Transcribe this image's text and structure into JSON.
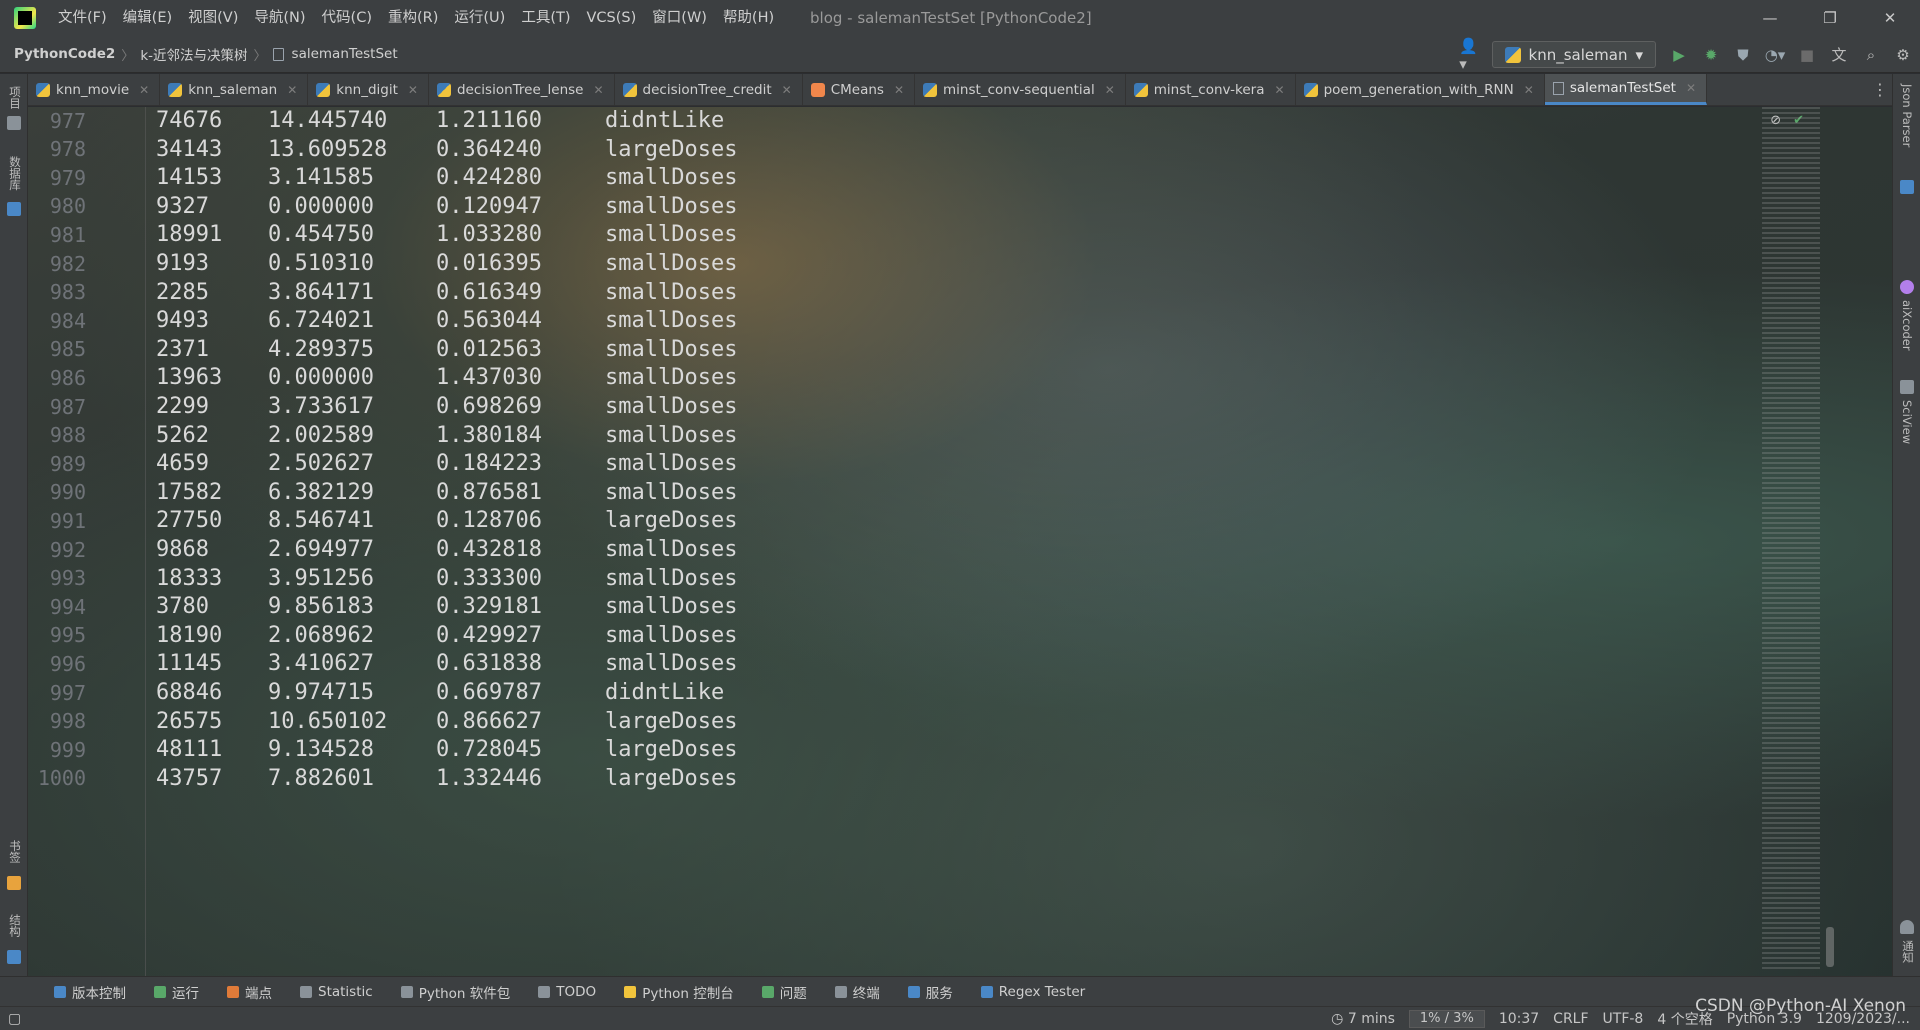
{
  "window": {
    "title": "blog - salemanTestSet [PythonCode2]",
    "controls": {
      "minimize": "—",
      "restore": "❐",
      "close": "✕"
    }
  },
  "menu": [
    "文件(F)",
    "编辑(E)",
    "视图(V)",
    "导航(N)",
    "代码(C)",
    "重构(R)",
    "运行(U)",
    "工具(T)",
    "VCS(S)",
    "窗口(W)",
    "帮助(H)"
  ],
  "breadcrumb": {
    "project": "PythonCode2",
    "folder": "k-近邻法与决策树",
    "file": "salemanTestSet"
  },
  "run_config": {
    "label": "knn_saleman"
  },
  "tabs": [
    {
      "label": "knn_movie",
      "icon": "python-file-icon"
    },
    {
      "label": "knn_saleman",
      "icon": "python-file-icon"
    },
    {
      "label": "knn_digit",
      "icon": "python-file-icon"
    },
    {
      "label": "decisionTree_lense",
      "icon": "python-file-icon"
    },
    {
      "label": "decisionTree_credit",
      "icon": "python-file-icon"
    },
    {
      "label": "CMeans",
      "icon": "python-file-icon"
    },
    {
      "label": "minst_conv-sequential",
      "icon": "python-file-icon"
    },
    {
      "label": "minst_conv-kera",
      "icon": "python-file-icon"
    },
    {
      "label": "poem_generation_with_RNN",
      "icon": "python-file-icon"
    },
    {
      "label": "salemanTestSet",
      "icon": "text-file-icon",
      "active": true
    }
  ],
  "left_panel": {
    "project": "项目",
    "database": "数据库",
    "bookmarks": "书签",
    "structure": "结构"
  },
  "right_panel": {
    "json_parser": "Json Parser",
    "plugin_unknown": "",
    "aixcoder": "aiXcoder",
    "sciview": "SciView",
    "notifications": "通知"
  },
  "lines": [
    {
      "n": "977",
      "a": "74676",
      "b": "14.445740",
      "c": "1.211160",
      "d": "didntLike"
    },
    {
      "n": "978",
      "a": "34143",
      "b": "13.609528",
      "c": "0.364240",
      "d": "largeDoses"
    },
    {
      "n": "979",
      "a": "14153",
      "b": "3.141585",
      "c": "0.424280",
      "d": "smallDoses"
    },
    {
      "n": "980",
      "a": "9327",
      "b": "0.000000",
      "c": "0.120947",
      "d": "smallDoses"
    },
    {
      "n": "981",
      "a": "18991",
      "b": "0.454750",
      "c": "1.033280",
      "d": "smallDoses"
    },
    {
      "n": "982",
      "a": "9193",
      "b": "0.510310",
      "c": "0.016395",
      "d": "smallDoses"
    },
    {
      "n": "983",
      "a": "2285",
      "b": "3.864171",
      "c": "0.616349",
      "d": "smallDoses"
    },
    {
      "n": "984",
      "a": "9493",
      "b": "6.724021",
      "c": "0.563044",
      "d": "smallDoses"
    },
    {
      "n": "985",
      "a": "2371",
      "b": "4.289375",
      "c": "0.012563",
      "d": "smallDoses"
    },
    {
      "n": "986",
      "a": "13963",
      "b": "0.000000",
      "c": "1.437030",
      "d": "smallDoses"
    },
    {
      "n": "987",
      "a": "2299",
      "b": "3.733617",
      "c": "0.698269",
      "d": "smallDoses"
    },
    {
      "n": "988",
      "a": "5262",
      "b": "2.002589",
      "c": "1.380184",
      "d": "smallDoses"
    },
    {
      "n": "989",
      "a": "4659",
      "b": "2.502627",
      "c": "0.184223",
      "d": "smallDoses"
    },
    {
      "n": "990",
      "a": "17582",
      "b": "6.382129",
      "c": "0.876581",
      "d": "smallDoses"
    },
    {
      "n": "991",
      "a": "27750",
      "b": "8.546741",
      "c": "0.128706",
      "d": "largeDoses"
    },
    {
      "n": "992",
      "a": "9868",
      "b": "2.694977",
      "c": "0.432818",
      "d": "smallDoses"
    },
    {
      "n": "993",
      "a": "18333",
      "b": "3.951256",
      "c": "0.333300",
      "d": "smallDoses"
    },
    {
      "n": "994",
      "a": "3780",
      "b": "9.856183",
      "c": "0.329181",
      "d": "smallDoses"
    },
    {
      "n": "995",
      "a": "18190",
      "b": "2.068962",
      "c": "0.429927",
      "d": "smallDoses"
    },
    {
      "n": "996",
      "a": "11145",
      "b": "3.410627",
      "c": "0.631838",
      "d": "smallDoses"
    },
    {
      "n": "997",
      "a": "68846",
      "b": "9.974715",
      "c": "0.669787",
      "d": "didntLike"
    },
    {
      "n": "998",
      "a": "26575",
      "b": "10.650102",
      "c": "0.866627",
      "d": "largeDoses"
    },
    {
      "n": "999",
      "a": "48111",
      "b": "9.134528",
      "c": "0.728045",
      "d": "largeDoses"
    },
    {
      "n": "1000",
      "a": "43757",
      "b": "7.882601",
      "c": "1.332446",
      "d": "largeDoses"
    }
  ],
  "tool_windows": [
    {
      "label": "版本控制",
      "icon": "vcs-icon"
    },
    {
      "label": "运行",
      "icon": "run-icon"
    },
    {
      "label": "端点",
      "icon": "endpoints-icon"
    },
    {
      "label": "Statistic",
      "icon": "statistic-icon"
    },
    {
      "label": "Python 软件包",
      "icon": "packages-icon"
    },
    {
      "label": "TODO",
      "icon": "todo-icon"
    },
    {
      "label": "Python 控制台",
      "icon": "python-console-icon"
    },
    {
      "label": "问题",
      "icon": "problems-icon"
    },
    {
      "label": "终端",
      "icon": "terminal-icon"
    },
    {
      "label": "服务",
      "icon": "services-icon"
    },
    {
      "label": "Regex Tester",
      "icon": "regex-icon"
    }
  ],
  "status": {
    "timer": "7 mins",
    "memory": "1% / 3%",
    "position": "10:37",
    "line_sep": "CRLF",
    "encoding": "UTF-8",
    "indent": "4 个空格",
    "interpreter": "Python 3.9",
    "date": "1209/2023/..."
  },
  "watermark": "CSDN @Python-AI Xenon",
  "colors": {
    "accent": "#4a88c7",
    "run_green": "#59a869",
    "background": "#3c3f41"
  }
}
